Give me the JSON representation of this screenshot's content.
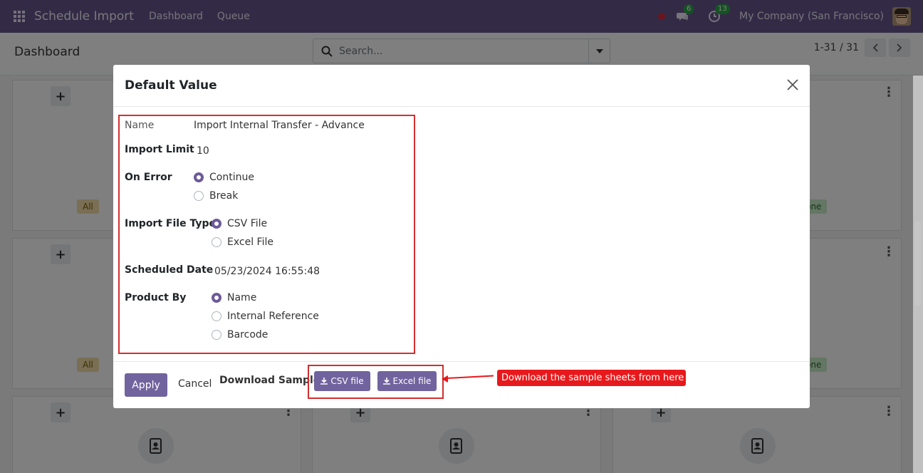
{
  "navbar": {
    "app_title": "Schedule Import",
    "links": [
      "Dashboard",
      "Queue"
    ],
    "chat_badge": "6",
    "activity_badge": "13",
    "company": "My Company (San Francisco)"
  },
  "control_panel": {
    "breadcrumb": "Dashboard",
    "search_placeholder": "Search...",
    "pager": "1-31 / 31"
  },
  "background": {
    "tags": [
      "All",
      "one",
      "All",
      "one"
    ],
    "plus": "+"
  },
  "modal": {
    "title": "Default Value",
    "fields": {
      "name_label": "Name",
      "name_value": "Import Internal Transfer - Advance",
      "import_limit_label": "Import Limit",
      "import_limit_value": "10",
      "on_error_label": "On Error",
      "on_error_options": [
        "Continue",
        "Break"
      ],
      "on_error_selected": "Continue",
      "file_type_label": "Import File Type",
      "file_type_options": [
        "CSV File",
        "Excel File"
      ],
      "file_type_selected": "CSV File",
      "scheduled_date_label": "Scheduled Date",
      "scheduled_date_value": "05/23/2024 16:55:48",
      "product_by_label": "Product By",
      "product_by_options": [
        "Name",
        "Internal Reference",
        "Barcode"
      ],
      "product_by_selected": "Name"
    },
    "footer": {
      "apply": "Apply",
      "cancel": "Cancel",
      "download_label": "Download Sample:",
      "csv_button": "CSV file",
      "excel_button": "Excel file"
    }
  },
  "annotation": {
    "callout_text": "Download the sample sheets from here",
    "color": "#e8191c"
  },
  "colors": {
    "navbar": "#67578c",
    "primary_button": "#71639e",
    "highlight_border": "#d32f2f"
  }
}
